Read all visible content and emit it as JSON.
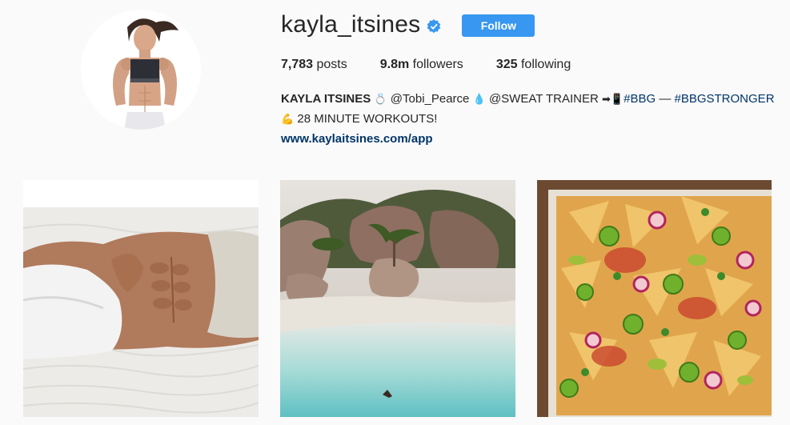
{
  "profile": {
    "username": "kayla_itsines",
    "follow_label": "Follow",
    "stats": {
      "posts_count": "7,783",
      "posts_label": "posts",
      "followers_count": "9.8m",
      "followers_label": "followers",
      "following_count": "325",
      "following_label": "following"
    },
    "bio": {
      "name": "KAYLA ITSINES",
      "ring_emoji": "💍",
      "mention": "@Tobi_Pearce",
      "drop_emoji": "💧",
      "title": "@SWEAT TRAINER",
      "arrow_emoji": "➡📱",
      "tag1": "#BBG",
      "dash": "—",
      "tag2": "#BBGSTRONGER",
      "muscle_emoji": "💪",
      "line2": "28 MINUTE WORKOUTS!",
      "website": "www.kaylaitsines.com/app"
    }
  },
  "colors": {
    "accent": "#3897f0",
    "link": "#003569",
    "background": "#fafafa"
  }
}
